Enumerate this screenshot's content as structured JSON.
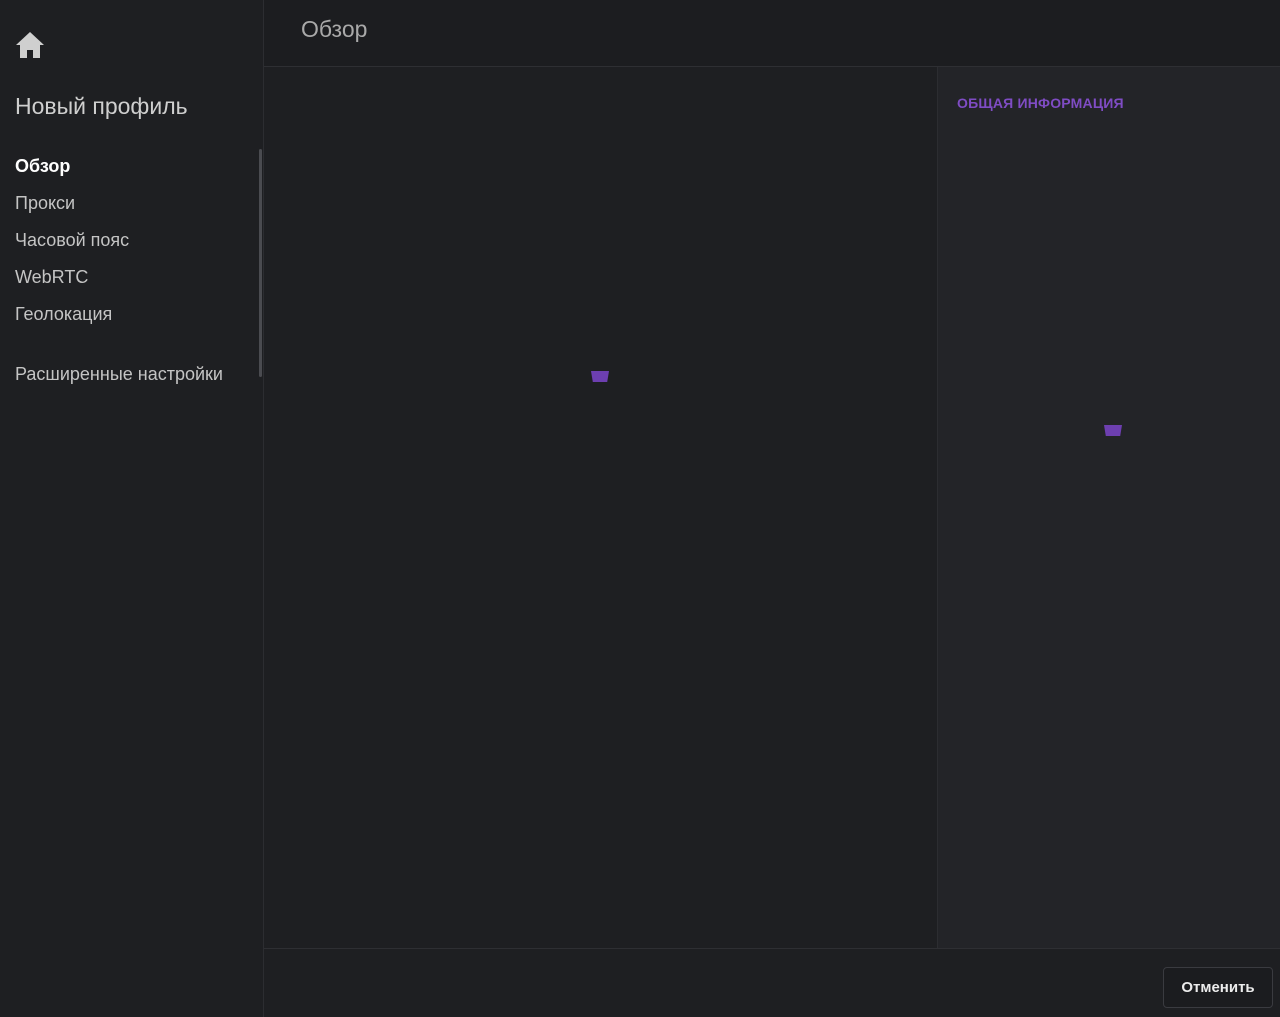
{
  "sidebar": {
    "home_icon": "home-icon",
    "profile_title": "Новый профиль",
    "items": [
      {
        "label": "Обзор",
        "active": true
      },
      {
        "label": "Прокси",
        "active": false
      },
      {
        "label": "Часовой пояс",
        "active": false
      },
      {
        "label": "WebRTC",
        "active": false
      },
      {
        "label": "Геолокация",
        "active": false
      }
    ],
    "extra_item": {
      "label": "Расширенные настройки"
    }
  },
  "header": {
    "title": "Обзор"
  },
  "info_panel": {
    "heading": "ОБЩАЯ ИНФОРМАЦИЯ"
  },
  "footer": {
    "cancel_label": "Отменить"
  },
  "colors": {
    "accent": "#7f4cc4",
    "loader": "#6d3fb0",
    "background": "#1e1f22",
    "panel": "#232428"
  }
}
